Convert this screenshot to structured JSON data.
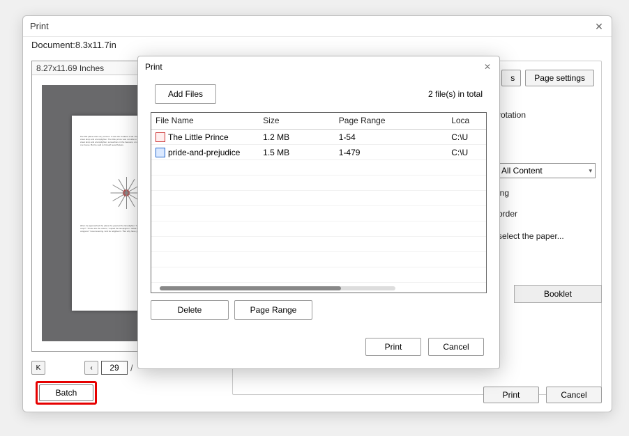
{
  "mainDialog": {
    "title": "Print",
    "documentLabel": "Document:8.3x11.7in",
    "previewCaption": "8.27x11.69 Inches",
    "pageCurrent": "29",
    "pageSep": "/",
    "pageSettingsBtn": "Page settings",
    "rightLines": {
      "rotation": "rotation",
      "allContent": "All Content",
      "ing": "ing",
      "order": "order",
      "paper": "select  the  paper..."
    },
    "bookletBtn": "Booklet",
    "printBtn": "Print",
    "cancelBtn": "Cancel",
    "batchBtn": "Batch"
  },
  "batchDialog": {
    "title": "Print",
    "addFilesBtn": "Add Files",
    "totalLabel": "2 file(s) in total",
    "cols": {
      "name": "File Name",
      "size": "Size",
      "range": "Page Range",
      "loc": "Loca"
    },
    "files": [
      {
        "name": "The Little Prince",
        "size": "1.2 MB",
        "range": "1-54",
        "loc": "C:\\U",
        "iconClass": ""
      },
      {
        "name": "pride-and-prejudice",
        "size": "1.5 MB",
        "range": "1-479",
        "loc": "C:\\U",
        "iconClass": "blue"
      }
    ],
    "deleteBtn": "Delete",
    "pageRangeBtn": "Page Range",
    "printBtn": "Print",
    "cancelBtn": "Cancel"
  }
}
